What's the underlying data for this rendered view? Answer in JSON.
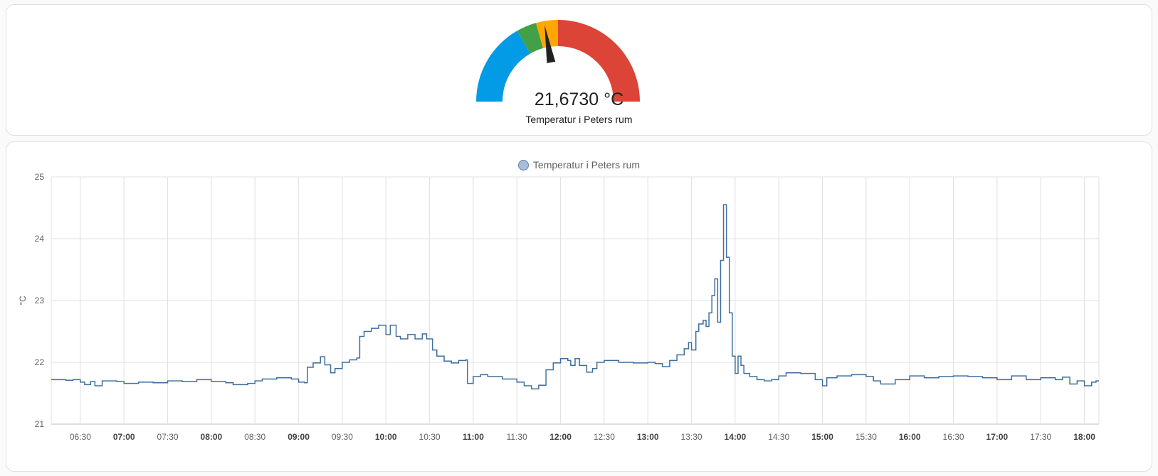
{
  "gauge": {
    "value_text": "21,6730 °C",
    "name": "Temperatur i Peters rum",
    "value": 21.673,
    "min": 15,
    "max": 30,
    "segments": [
      {
        "from": 15,
        "to": 20,
        "color": "#039be5"
      },
      {
        "from": 20,
        "to": 21.2,
        "color": "#43a047"
      },
      {
        "from": 21.2,
        "to": 21.6,
        "color": "#ffa600"
      },
      {
        "from": 21.6,
        "to": 22.5,
        "color": "#ffa600"
      },
      {
        "from": 22.5,
        "to": 30,
        "color": "#db4437"
      }
    ],
    "needle_color": "#212121"
  },
  "chart_data": {
    "type": "line",
    "title": "",
    "legend": {
      "position": "top-center"
    },
    "ylabel": "°C",
    "xlabel": "",
    "ylim": [
      21,
      25
    ],
    "y_ticks": [
      "21",
      "22",
      "23",
      "24",
      "25"
    ],
    "xlim": [
      "06:10",
      "18:10"
    ],
    "x_ticks": [
      {
        "label": "06:30",
        "major": false
      },
      {
        "label": "07:00",
        "major": true
      },
      {
        "label": "07:30",
        "major": false
      },
      {
        "label": "08:00",
        "major": true
      },
      {
        "label": "08:30",
        "major": false
      },
      {
        "label": "09:00",
        "major": true
      },
      {
        "label": "09:30",
        "major": false
      },
      {
        "label": "10:00",
        "major": true
      },
      {
        "label": "10:30",
        "major": false
      },
      {
        "label": "11:00",
        "major": true
      },
      {
        "label": "11:30",
        "major": false
      },
      {
        "label": "12:00",
        "major": true
      },
      {
        "label": "12:30",
        "major": false
      },
      {
        "label": "13:00",
        "major": true
      },
      {
        "label": "13:30",
        "major": false
      },
      {
        "label": "14:00",
        "major": true
      },
      {
        "label": "14:30",
        "major": false
      },
      {
        "label": "15:00",
        "major": true
      },
      {
        "label": "15:30",
        "major": false
      },
      {
        "label": "16:00",
        "major": true
      },
      {
        "label": "16:30",
        "major": false
      },
      {
        "label": "17:00",
        "major": true
      },
      {
        "label": "17:30",
        "major": false
      },
      {
        "label": "18:00",
        "major": true
      }
    ],
    "grid": true,
    "step": true,
    "series": [
      {
        "name": "Temperatur i Peters rum",
        "color": "#3f6e9e",
        "points": [
          [
            "06:10",
            21.72
          ],
          [
            "06:20",
            21.71
          ],
          [
            "06:25",
            21.72
          ],
          [
            "06:30",
            21.68
          ],
          [
            "06:33",
            21.64
          ],
          [
            "06:37",
            21.69
          ],
          [
            "06:40",
            21.62
          ],
          [
            "06:45",
            21.7
          ],
          [
            "06:55",
            21.69
          ],
          [
            "07:00",
            21.66
          ],
          [
            "07:10",
            21.68
          ],
          [
            "07:20",
            21.67
          ],
          [
            "07:30",
            21.7
          ],
          [
            "07:40",
            21.69
          ],
          [
            "07:50",
            21.72
          ],
          [
            "08:00",
            21.69
          ],
          [
            "08:10",
            21.67
          ],
          [
            "08:15",
            21.64
          ],
          [
            "08:25",
            21.66
          ],
          [
            "08:30",
            21.7
          ],
          [
            "08:35",
            21.73
          ],
          [
            "08:45",
            21.75
          ],
          [
            "08:55",
            21.73
          ],
          [
            "09:00",
            21.68
          ],
          [
            "09:04",
            21.67
          ],
          [
            "09:06",
            21.92
          ],
          [
            "09:10",
            21.99
          ],
          [
            "09:15",
            22.09
          ],
          [
            "09:18",
            21.96
          ],
          [
            "09:22",
            21.83
          ],
          [
            "09:25",
            21.9
          ],
          [
            "09:30",
            22.0
          ],
          [
            "09:35",
            22.04
          ],
          [
            "09:40",
            22.07
          ],
          [
            "09:42",
            22.42
          ],
          [
            "09:45",
            22.5
          ],
          [
            "09:50",
            22.55
          ],
          [
            "09:55",
            22.6
          ],
          [
            "10:00",
            22.45
          ],
          [
            "10:03",
            22.6
          ],
          [
            "10:07",
            22.42
          ],
          [
            "10:10",
            22.38
          ],
          [
            "10:15",
            22.45
          ],
          [
            "10:20",
            22.38
          ],
          [
            "10:25",
            22.46
          ],
          [
            "10:28",
            22.38
          ],
          [
            "10:32",
            22.2
          ],
          [
            "10:35",
            22.1
          ],
          [
            "10:40",
            22.02
          ],
          [
            "10:45",
            21.99
          ],
          [
            "10:50",
            22.03
          ],
          [
            "10:55",
            22.04
          ],
          [
            "10:56",
            21.66
          ],
          [
            "11:00",
            21.77
          ],
          [
            "11:05",
            21.8
          ],
          [
            "11:10",
            21.77
          ],
          [
            "11:20",
            21.73
          ],
          [
            "11:30",
            21.68
          ],
          [
            "11:35",
            21.62
          ],
          [
            "11:40",
            21.57
          ],
          [
            "11:45",
            21.63
          ],
          [
            "11:50",
            21.88
          ],
          [
            "11:55",
            21.99
          ],
          [
            "12:00",
            22.06
          ],
          [
            "12:05",
            22.03
          ],
          [
            "12:07",
            21.95
          ],
          [
            "12:10",
            22.06
          ],
          [
            "12:13",
            21.95
          ],
          [
            "12:18",
            21.84
          ],
          [
            "12:22",
            21.9
          ],
          [
            "12:25",
            22.0
          ],
          [
            "12:30",
            22.03
          ],
          [
            "12:40",
            22.0
          ],
          [
            "12:50",
            21.99
          ],
          [
            "13:00",
            22.0
          ],
          [
            "13:05",
            21.98
          ],
          [
            "13:10",
            21.93
          ],
          [
            "13:15",
            22.03
          ],
          [
            "13:20",
            22.12
          ],
          [
            "13:25",
            22.22
          ],
          [
            "13:28",
            22.32
          ],
          [
            "13:30",
            22.2
          ],
          [
            "13:33",
            22.5
          ],
          [
            "13:35",
            22.62
          ],
          [
            "13:38",
            22.68
          ],
          [
            "13:40",
            22.58
          ],
          [
            "13:42",
            22.8
          ],
          [
            "13:44",
            23.08
          ],
          [
            "13:46",
            23.35
          ],
          [
            "13:48",
            22.65
          ],
          [
            "13:50",
            23.65
          ],
          [
            "13:52",
            24.55
          ],
          [
            "13:54",
            23.7
          ],
          [
            "13:56",
            22.8
          ],
          [
            "13:58",
            22.1
          ],
          [
            "14:00",
            21.82
          ],
          [
            "14:02",
            22.1
          ],
          [
            "14:04",
            21.95
          ],
          [
            "14:06",
            21.82
          ],
          [
            "14:10",
            21.77
          ],
          [
            "14:15",
            21.72
          ],
          [
            "14:20",
            21.7
          ],
          [
            "14:25",
            21.72
          ],
          [
            "14:30",
            21.78
          ],
          [
            "14:35",
            21.83
          ],
          [
            "14:45",
            21.82
          ],
          [
            "14:55",
            21.72
          ],
          [
            "15:00",
            21.62
          ],
          [
            "15:03",
            21.75
          ],
          [
            "15:10",
            21.78
          ],
          [
            "15:20",
            21.8
          ],
          [
            "15:30",
            21.77
          ],
          [
            "15:35",
            21.7
          ],
          [
            "15:40",
            21.65
          ],
          [
            "15:50",
            21.72
          ],
          [
            "16:00",
            21.78
          ],
          [
            "16:10",
            21.75
          ],
          [
            "16:20",
            21.77
          ],
          [
            "16:30",
            21.78
          ],
          [
            "16:40",
            21.77
          ],
          [
            "16:50",
            21.75
          ],
          [
            "17:00",
            21.72
          ],
          [
            "17:10",
            21.78
          ],
          [
            "17:20",
            21.72
          ],
          [
            "17:30",
            21.75
          ],
          [
            "17:40",
            21.72
          ],
          [
            "17:45",
            21.76
          ],
          [
            "17:50",
            21.65
          ],
          [
            "17:55",
            21.7
          ],
          [
            "18:00",
            21.62
          ],
          [
            "18:05",
            21.68
          ],
          [
            "18:08",
            21.7
          ]
        ]
      }
    ]
  }
}
